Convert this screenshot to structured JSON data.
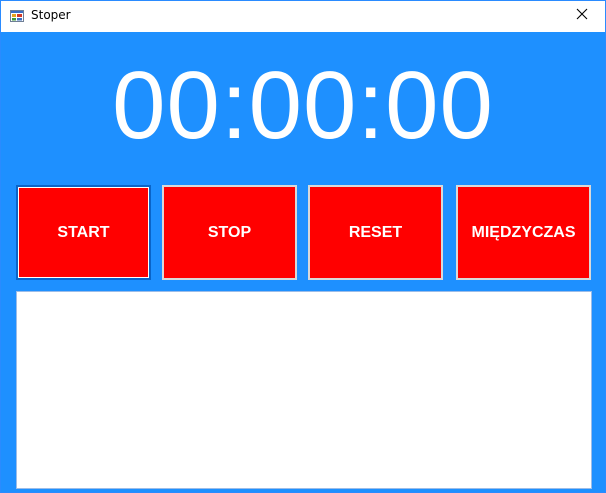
{
  "window": {
    "title": "Stoper",
    "app_icon": "winforms-app-icon",
    "close_icon": "close-icon"
  },
  "timer": {
    "display": "00:00:00"
  },
  "buttons": {
    "start": "START",
    "stop": "STOP",
    "reset": "RESET",
    "lap": "MIĘDZYCZAS"
  },
  "laps": {
    "items": []
  },
  "colors": {
    "background": "#1e90ff",
    "button": "#ff0000",
    "text": "#ffffff"
  }
}
